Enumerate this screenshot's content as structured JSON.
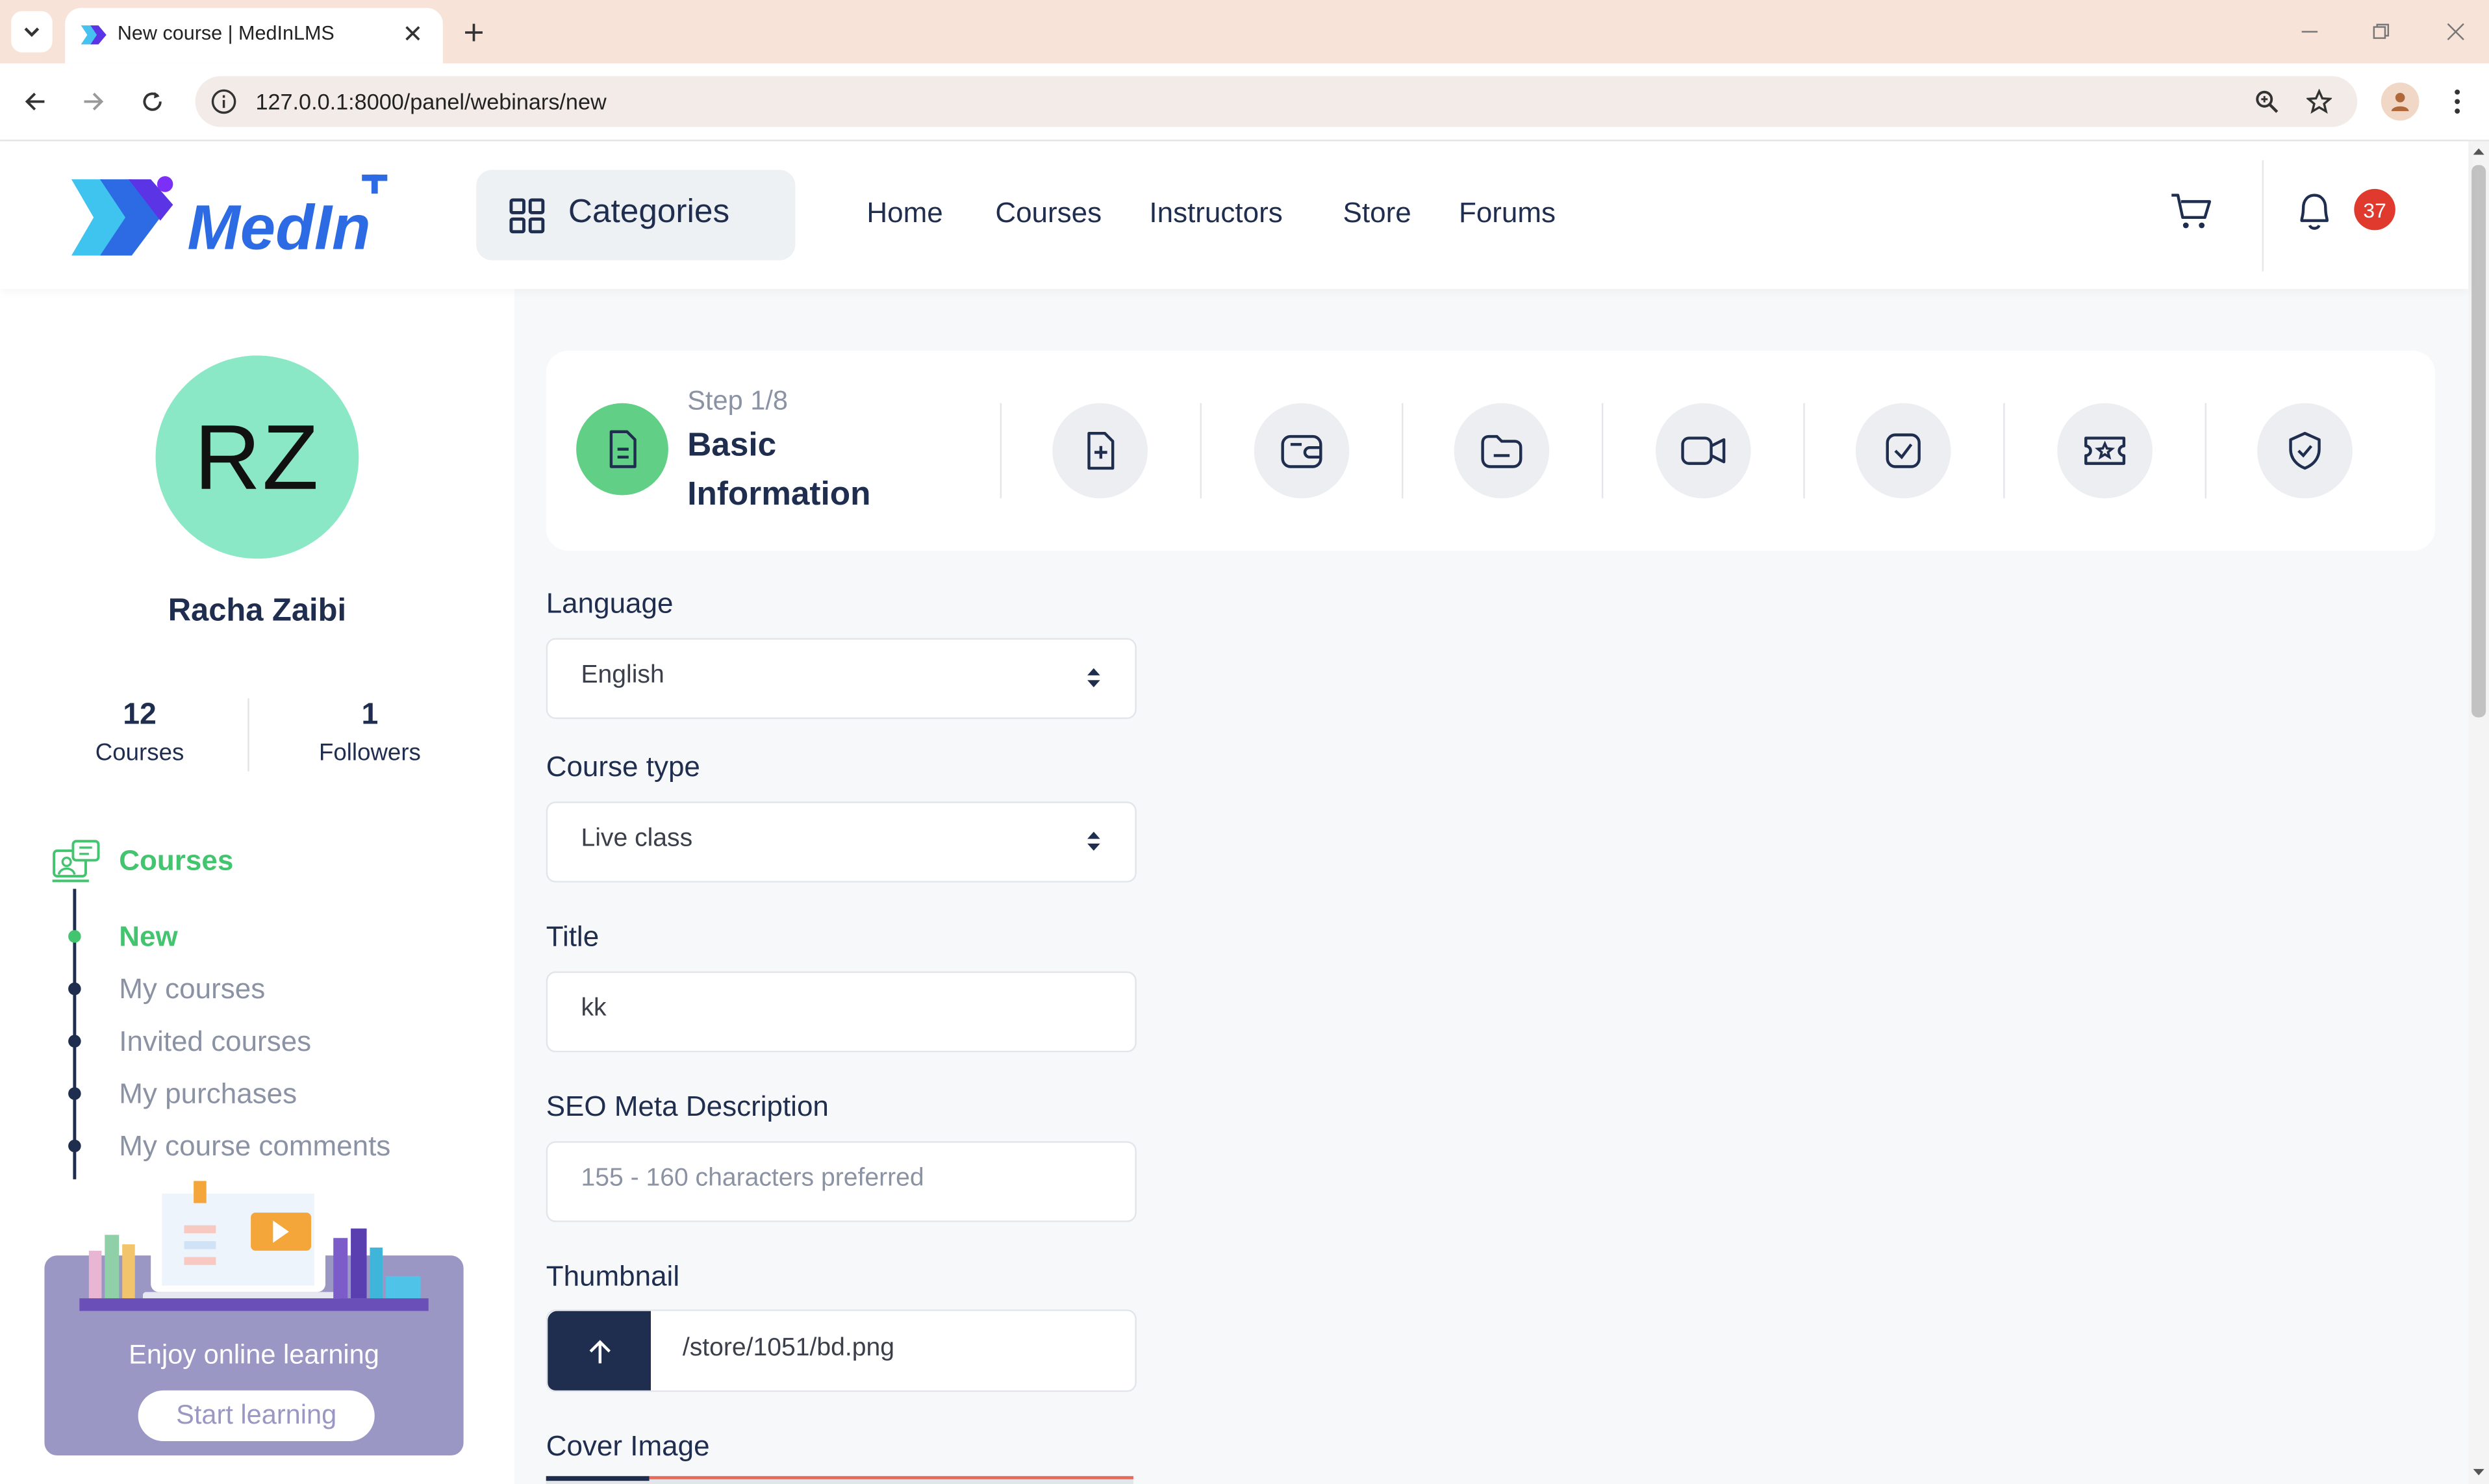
{
  "browser": {
    "tab_title": "New course | MedInLMS",
    "url": "127.0.0.1:8000/panel/webinars/new",
    "icons": [
      "tab-search-icon",
      "close-icon",
      "plus-icon",
      "minimize-icon",
      "restore-icon",
      "window-close-icon",
      "back-arrow-icon",
      "forward-arrow-icon",
      "reload-icon",
      "info-icon",
      "zoom-icon",
      "star-icon",
      "profile-icon",
      "more-vertical-icon"
    ]
  },
  "header": {
    "logo_text": "MedIn",
    "categories_label": "Categories",
    "nav": [
      "Home",
      "Courses",
      "Instructors",
      "Store",
      "Forums"
    ],
    "notification_count": "37",
    "colors": {
      "brand_blue": "#2d6be4",
      "brand_purple": "#7b2ff7",
      "badge_red": "#e03a2e"
    }
  },
  "sidebar": {
    "avatar_initials": "RZ",
    "user_name": "Racha Zaibi",
    "stats": [
      {
        "value": "12",
        "label": "Courses"
      },
      {
        "value": "1",
        "label": "Followers"
      }
    ],
    "menu_title": "Courses",
    "menu_items": [
      "New",
      "My courses",
      "Invited courses",
      "My purchases",
      "My course comments"
    ],
    "active_item": "New",
    "promo_text": "Enjoy online learning",
    "promo_button": "Start learning",
    "colors": {
      "accent_green": "#43c46f",
      "avatar_bg": "#8be8c6",
      "promo_bg": "#9a97c4"
    }
  },
  "steps": {
    "step_label": "Step 1/8",
    "step_title": "Basic Information",
    "step_icons": [
      "file-text-icon",
      "file-plus-icon",
      "wallet-icon",
      "folder-minus-icon",
      "video-icon",
      "checkbox-icon",
      "ticket-star-icon",
      "shield-check-icon"
    ]
  },
  "form": {
    "language": {
      "label": "Language",
      "value": "English"
    },
    "course_type": {
      "label": "Course type",
      "value": "Live class"
    },
    "title": {
      "label": "Title",
      "value": "kk"
    },
    "seo": {
      "label": "SEO Meta Description",
      "placeholder": "155 - 160 characters preferred"
    },
    "thumbnail": {
      "label": "Thumbnail",
      "value": "/store/1051/bd.png"
    },
    "cover": {
      "label": "Cover Image"
    }
  }
}
